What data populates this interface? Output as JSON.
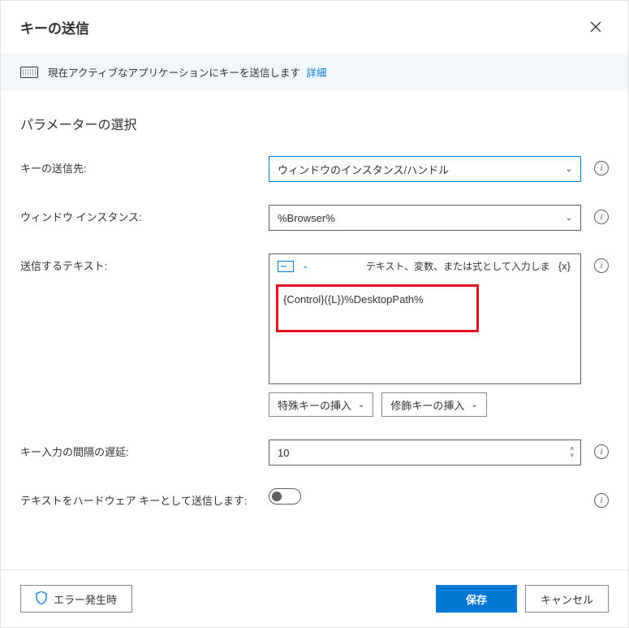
{
  "dialog": {
    "title": "キーの送信",
    "info_text": "現在アクティブなアプリケーションにキーを送信します",
    "info_link": "詳細"
  },
  "section": {
    "title": "パラメーターの選択"
  },
  "fields": {
    "destination": {
      "label": "キーの送信先:",
      "value": "ウィンドウのインスタンス/ハンドル"
    },
    "instance": {
      "label": "ウィンドウ インスタンス:",
      "value": "%Browser%"
    },
    "text_to_send": {
      "label": "送信するテキスト:",
      "hint": "テキスト、変数、または式として入力しま",
      "var_btn": "{x}",
      "content": "{Control}({L})%DesktopPath%"
    },
    "insert": {
      "special_keys": "特殊キーの挿入",
      "modifier_keys": "修飾キーの挿入"
    },
    "delay": {
      "label": "キー入力の間隔の遅延:",
      "value": "10"
    },
    "hardware": {
      "label": "テキストをハードウェア キーとして送信します:"
    }
  },
  "footer": {
    "on_error": "エラー発生時",
    "save": "保存",
    "cancel": "キャンセル"
  }
}
